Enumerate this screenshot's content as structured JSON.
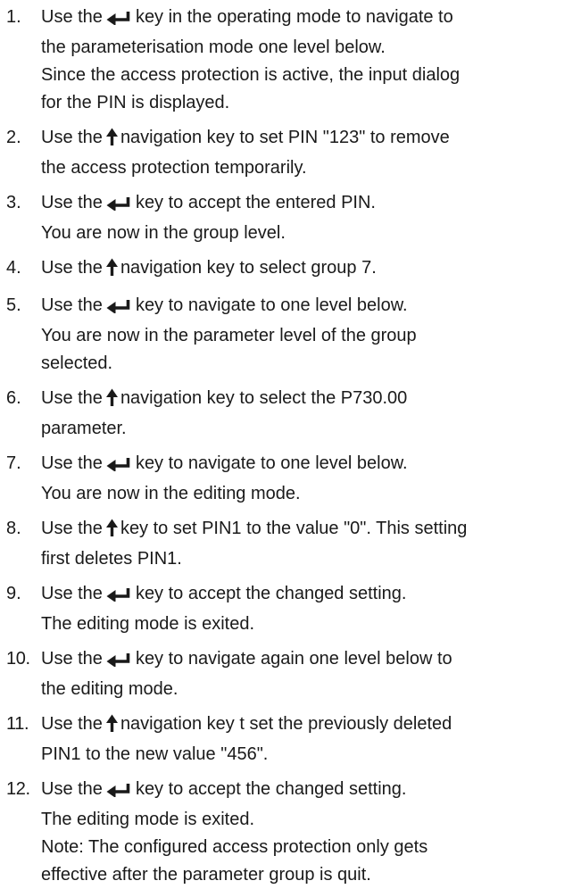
{
  "steps": [
    {
      "number": "1.",
      "before_icon": "Use the",
      "icon": "enter-key-icon",
      "after_icon": "key in the operating mode to navigate to",
      "continuation": [
        "the parameterisation mode one level below."
      ],
      "notes": [
        "Since the access protection is active, the input dialog",
        "for the PIN is displayed."
      ]
    },
    {
      "number": "2.",
      "before_icon": "Use the",
      "icon": "up-arrow-icon",
      "after_icon": "navigation key to set PIN \"123\" to remove",
      "continuation": [
        "the access protection temporarily."
      ],
      "notes": []
    },
    {
      "number": "3.",
      "before_icon": "Use the",
      "icon": "enter-key-icon",
      "after_icon": "key to accept the entered PIN.",
      "continuation": [],
      "notes": [
        "You are now in the group level."
      ]
    },
    {
      "number": "4.",
      "before_icon": "Use the",
      "icon": "up-arrow-icon",
      "after_icon": "navigation key to select group 7.",
      "continuation": [],
      "notes": []
    },
    {
      "number": "5.",
      "before_icon": "Use the",
      "icon": "enter-key-icon",
      "after_icon": "key to navigate to one level below.",
      "continuation": [],
      "notes": [
        "You are now in the parameter level of the group",
        "selected."
      ]
    },
    {
      "number": "6.",
      "before_icon": "Use the",
      "icon": "up-arrow-icon",
      "after_icon": "navigation key to select the P730.00",
      "continuation": [
        "parameter."
      ],
      "notes": []
    },
    {
      "number": "7.",
      "before_icon": "Use the",
      "icon": "enter-key-icon",
      "after_icon": "key to navigate to one level below.",
      "continuation": [],
      "notes": [
        "You are now in the editing mode."
      ]
    },
    {
      "number": "8.",
      "before_icon": "Use the",
      "icon": "up-arrow-icon",
      "after_icon": "key to set PIN1 to the value \"0\". This setting",
      "continuation": [
        "first deletes PIN1."
      ],
      "notes": []
    },
    {
      "number": "9.",
      "before_icon": "Use the",
      "icon": "enter-key-icon",
      "after_icon": "key to accept the changed setting.",
      "continuation": [],
      "notes": [
        "The editing mode is exited."
      ]
    },
    {
      "number": "10.",
      "before_icon": "Use the",
      "icon": "enter-key-icon",
      "after_icon": "key to navigate again one level below to",
      "continuation": [
        "the editing mode."
      ],
      "notes": []
    },
    {
      "number": "11.",
      "before_icon": "Use the",
      "icon": "up-arrow-icon",
      "after_icon": "navigation key t set the previously deleted",
      "continuation": [
        "PIN1 to the new value \"456\"."
      ],
      "notes": []
    },
    {
      "number": "12.",
      "before_icon": "Use the",
      "icon": "enter-key-icon",
      "after_icon": "key to accept the changed setting.",
      "continuation": [],
      "notes": [
        "The editing mode is exited.",
        "Note: The configured access protection only gets",
        "effective after the parameter group is quit."
      ]
    }
  ]
}
